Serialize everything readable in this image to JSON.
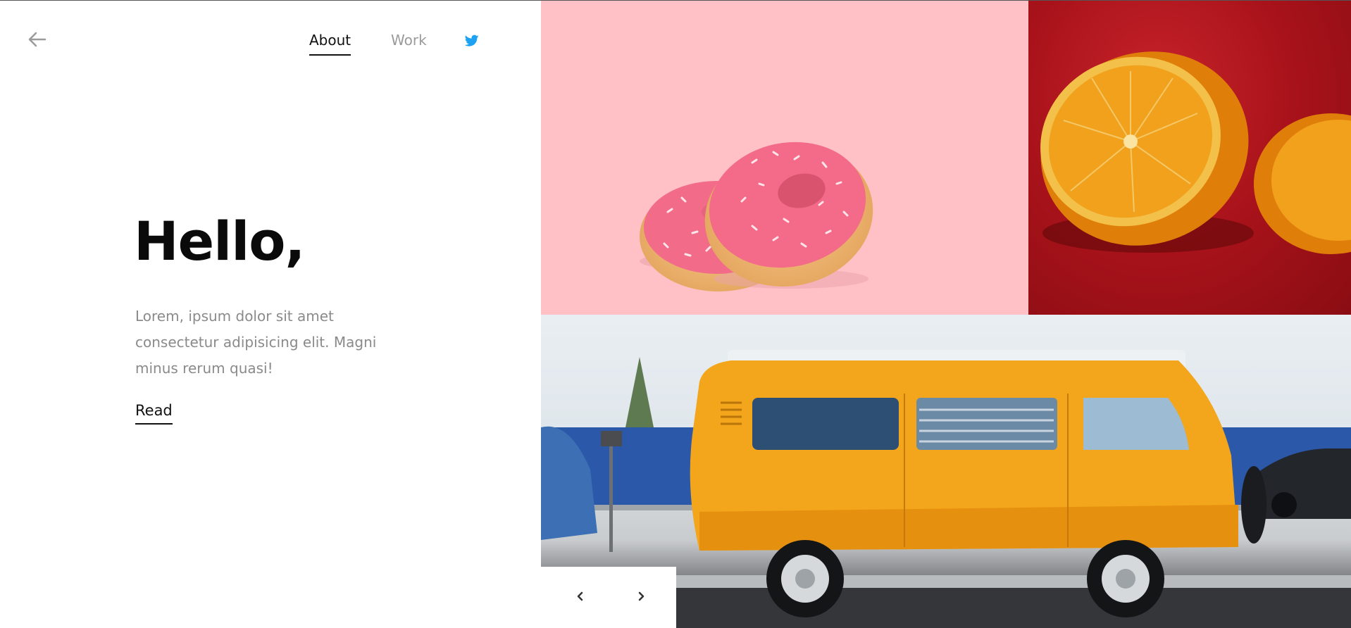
{
  "nav": {
    "about_label": "About",
    "work_label": "Work"
  },
  "hero": {
    "title": "Hello,",
    "body": "Lorem, ipsum dolor sit amet consectetur adipisicing elit. Magni minus rerum quasi!",
    "read_label": "Read"
  },
  "icons": {
    "back": "arrow-left-icon",
    "twitter": "twitter-icon",
    "prev": "chevron-left-icon",
    "next": "chevron-right-icon"
  },
  "colors": {
    "donut_bg": "#ffc1c6",
    "orange_bg": "#a8121a",
    "twitter_blue": "#1da1f2",
    "van_yellow": "#f3a51b"
  }
}
